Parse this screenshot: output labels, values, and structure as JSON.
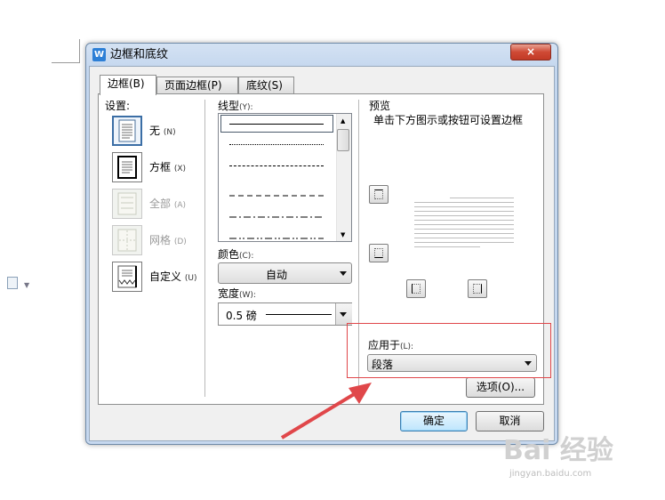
{
  "dialog": {
    "title": "边框和底纹",
    "app_icon_letter": "W",
    "close_glyph": "×"
  },
  "tabs": [
    {
      "label": "边框(B)",
      "active": true
    },
    {
      "label": "页面边框(P)",
      "active": false
    },
    {
      "label": "底纹(S)",
      "active": false
    }
  ],
  "settings": {
    "label": "设置:",
    "items": [
      {
        "label": "无",
        "key": "(N)",
        "enabled": true
      },
      {
        "label": "方框",
        "key": "(X)",
        "enabled": true
      },
      {
        "label": "全部",
        "key": "(A)",
        "enabled": false
      },
      {
        "label": "网格",
        "key": "(D)",
        "enabled": false
      },
      {
        "label": "自定义",
        "key": "(U)",
        "enabled": true
      }
    ]
  },
  "line_style": {
    "label": "线型",
    "key": "(Y):"
  },
  "color": {
    "label": "颜色",
    "key": "(C):",
    "value": "自动"
  },
  "width": {
    "label": "宽度",
    "key": "(W):",
    "value": "0.5  磅"
  },
  "preview": {
    "label": "预览",
    "hint": "单击下方图示或按钮可设置边框"
  },
  "apply_to": {
    "label": "应用于",
    "key": "(L):",
    "value": "段落"
  },
  "buttons": {
    "options": "选项(O)...",
    "ok": "确定",
    "cancel": "取消"
  },
  "watermark": {
    "brand": "Bai 经验",
    "url": "jingyan.baidu.com"
  },
  "colors": {
    "annotation_red": "#e0474a",
    "titlebar": "#c6d8ef",
    "close_red": "#cf4a35"
  }
}
